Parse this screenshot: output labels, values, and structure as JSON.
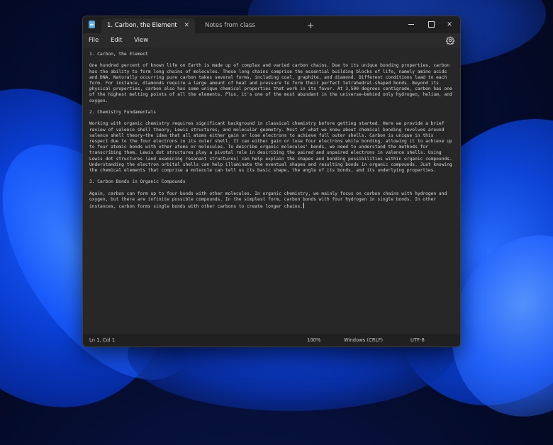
{
  "window": {
    "tabs": [
      {
        "label": "1. Carbon, the Element",
        "active": true
      },
      {
        "label": "Notes from class",
        "active": false
      }
    ],
    "add_tab_glyph": "+",
    "close_glyph": "✕"
  },
  "menu": {
    "file": "File",
    "edit": "Edit",
    "view": "View"
  },
  "document": {
    "paragraphs": [
      "1. Carbon, the Element",
      "One hundred percent of known life on Earth is made up of complex and varied carbon chains. Due to its unique bonding properties, carbon has the ability to form long chains of molecules. These long chains comprise the essential building blocks of life, namely amino acids and DNA. Naturally occurring pure carbon takes several forms, including coal, graphite, and diamond. Different conditions lead to each form. For instance, diamonds require a large amount of heat and pressure to form their perfect tetrahedral-shaped bonds. Beyond its physical properties, carbon also has some unique chemical properties that work in its favor. At 3,500 degrees centigrade, carbon has one of the highest melting points of all the elements. Plus, it's one of the most abundant in the universe—behind only hydrogen, helium, and oxygen.",
      "2. Chemistry Fundamentals",
      "Working with organic chemistry requires significant background in classical chemistry before getting started. Here we provide a brief review of valence shell theory, Lewis structures, and molecular geometry. Most of what we know about chemical bonding revolves around valence shell theory—the idea that all atoms either gain or lose electrons to achieve full outer shells. Carbon is unique in this respect due to the four electrons in its outer shell. It can either gain or lose four electrons while bonding, allowing it to achieve up to four atomic bonds with other atoms or molecules. To describe organic molecules' bonds, we need to understand the methods for transcribing them. Lewis dot structures play a pivotal role in describing the paired and unpaired electrons in valence shells. Using Lewis dot structures (and examining resonant structures) can help explain the shapes and bonding possibilities within organic compounds. Understanding the electron orbital shells can help illuminate the eventual shapes and resulting bonds in organic compounds. Just knowing the chemical elements that comprise a molecule can tell us its basic shape, the angle of its bonds, and its underlying properties.",
      "3. Carbon Bonds in Organic Compounds",
      "Again, carbon can form up to four bonds with other molecules. In organic chemistry, we mainly focus on carbon chains with hydrogen and oxygen, but there are infinite possible compounds. In the simplest form, carbon bonds with four hydrogen in single bonds. In other instances, carbon forms single bonds with other carbons to create longer chains."
    ]
  },
  "status": {
    "position": "Ln 1, Col 1",
    "zoom": "100%",
    "line_ending": "Windows (CRLF)",
    "encoding": "UTF-8"
  }
}
